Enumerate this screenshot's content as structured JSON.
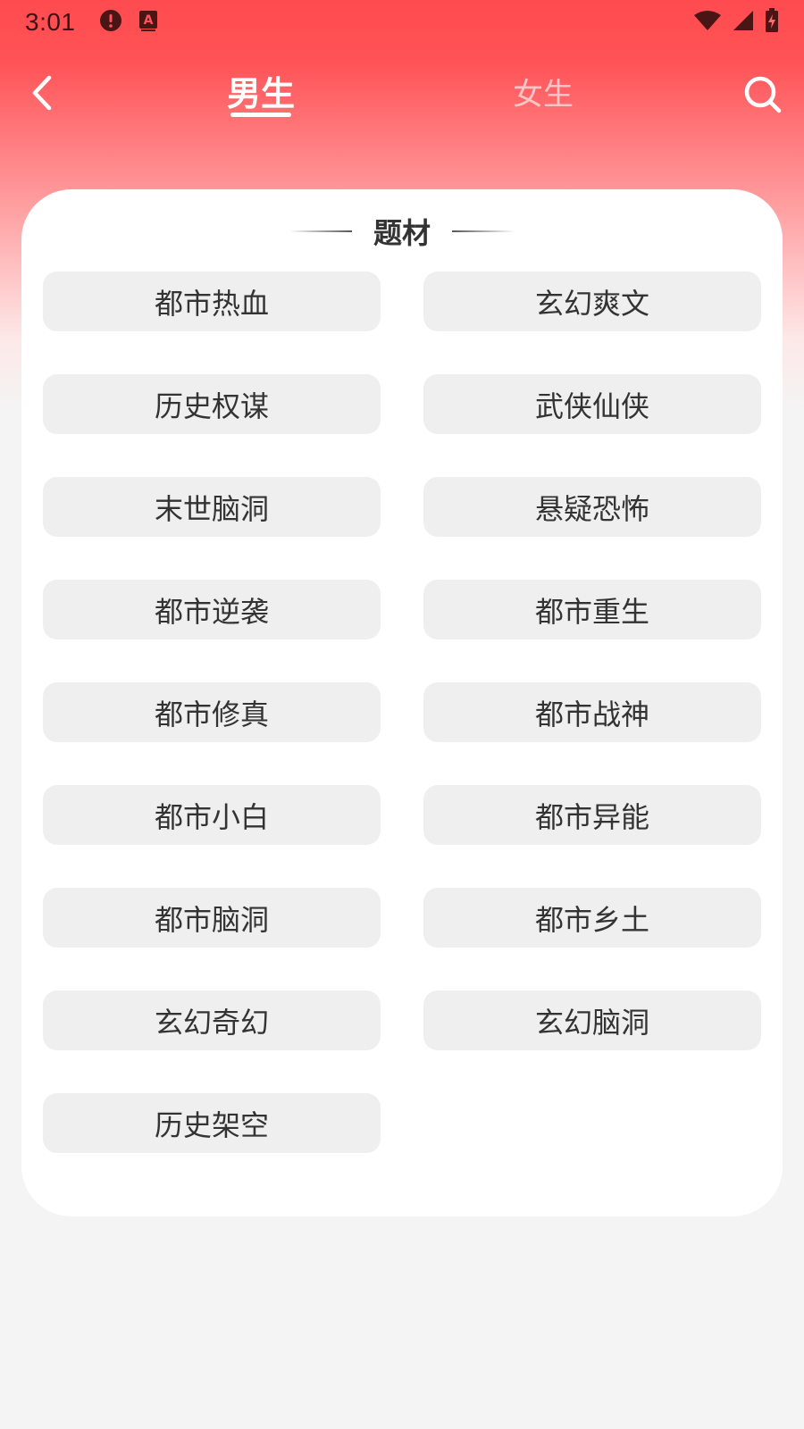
{
  "status_bar": {
    "time": "3:01",
    "icons_left": [
      "alert-circle-icon",
      "text-a-icon"
    ],
    "icons_right": [
      "wifi-icon",
      "signal-icon",
      "battery-charging-icon"
    ]
  },
  "header": {
    "tabs": [
      {
        "label": "男生",
        "active": true
      },
      {
        "label": "女生",
        "active": false
      }
    ]
  },
  "section": {
    "title": "题材",
    "tags": [
      "都市热血",
      "玄幻爽文",
      "历史权谋",
      "武侠仙侠",
      "末世脑洞",
      "悬疑恐怖",
      "都市逆袭",
      "都市重生",
      "都市修真",
      "都市战神",
      "都市小白",
      "都市异能",
      "都市脑洞",
      "都市乡土",
      "玄幻奇幻",
      "玄幻脑洞",
      "历史架空"
    ]
  },
  "colors": {
    "header_red": "#ff4b4f",
    "tag_bg": "#efefef",
    "text_dark": "#333333"
  }
}
